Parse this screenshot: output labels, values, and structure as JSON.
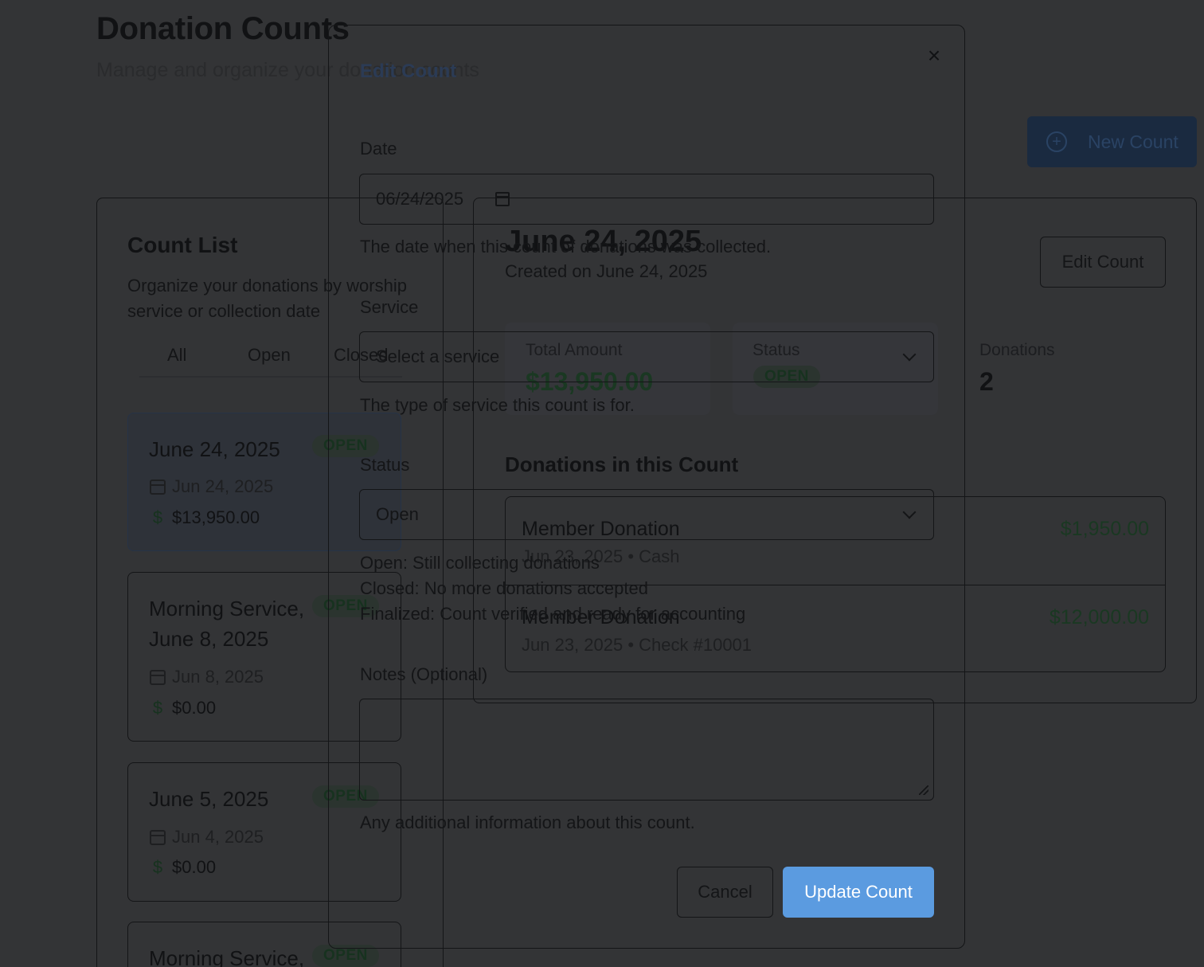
{
  "page": {
    "title": "Donation Counts",
    "subtitle": "Manage and organize your donation counts",
    "new_count_label": "New Count"
  },
  "list": {
    "title": "Count List",
    "description": "Organize your donations by worship service or collection date",
    "tabs": [
      "All",
      "Open",
      "Closed"
    ],
    "items": [
      {
        "title": "June 24, 2025",
        "badge": "OPEN",
        "date": "Jun 24, 2025",
        "amount": "$13,950.00"
      },
      {
        "title": "Morning Service, June 8, 2025",
        "badge": "OPEN",
        "date": "Jun 8, 2025",
        "amount": "$0.00"
      },
      {
        "title": "June 5, 2025",
        "badge": "OPEN",
        "date": "Jun 4, 2025",
        "amount": "$0.00"
      },
      {
        "title": "Morning Service,",
        "badge": "OPEN"
      }
    ]
  },
  "detail": {
    "title": "June 24, 2025",
    "created": "Created on June 24, 2025",
    "edit_label": "Edit Count",
    "stats": {
      "total_label": "Total Amount",
      "total_value": "$13,950.00",
      "status_label": "Status",
      "status_value": "OPEN",
      "donations_label": "Donations",
      "donations_value": "2"
    },
    "section_title": "Donations in this Count",
    "donations": [
      {
        "name": "Member Donation",
        "meta": "Jun 23, 2025 • Cash",
        "amount": "$1,950.00"
      },
      {
        "name": "Member Donation",
        "meta": "Jun 23, 2025 • Check #10001",
        "amount": "$12,000.00"
      }
    ]
  },
  "modal": {
    "title": "Edit Count",
    "close_icon": "×",
    "date_label": "Date",
    "date_value": "06/24/2025",
    "date_help": "The date when this count of donations was collected.",
    "service_label": "Service",
    "service_placeholder": "Select a service",
    "service_help": "The type of service this count is for.",
    "status_label": "Status",
    "status_value": "Open",
    "status_help": [
      "Open: Still collecting donations",
      "Closed: No more donations accepted",
      "Finalized: Count verified and ready for accounting"
    ],
    "notes_label": "Notes (Optional)",
    "notes_value": "",
    "notes_help": "Any additional information about this count.",
    "cancel_label": "Cancel",
    "submit_label": "Update Count"
  },
  "colors": {
    "overlay": "#333436",
    "primary": "#5b9be0",
    "success_text": "#1a3822"
  }
}
